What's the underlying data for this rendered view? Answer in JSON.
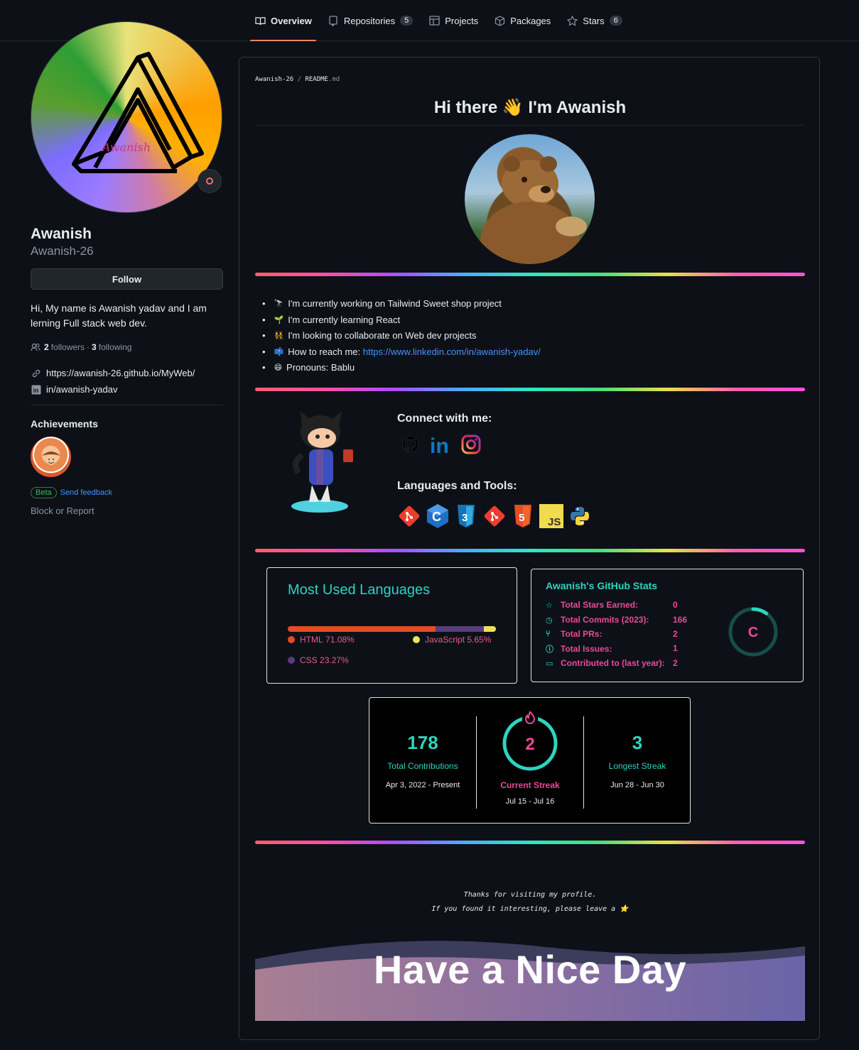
{
  "nav": {
    "tabs": [
      {
        "label": "Overview",
        "count": ""
      },
      {
        "label": "Repositories",
        "count": "5"
      },
      {
        "label": "Projects",
        "count": ""
      },
      {
        "label": "Packages",
        "count": ""
      },
      {
        "label": "Stars",
        "count": "6"
      }
    ]
  },
  "profile": {
    "avatar_text": "Awanish",
    "full_name": "Awanish",
    "username": "Awanish-26",
    "follow_label": "Follow",
    "bio": "Hi, My name is Awanish yadav and I am lerning Full stack web dev.",
    "followers_count": "2",
    "followers_label": "followers",
    "following_count": "3",
    "following_label": "following",
    "website": "https://awanish-26.github.io/MyWeb/",
    "linkedin": "in/awanish-yadav",
    "achievements_title": "Achievements",
    "beta_label": "Beta",
    "feedback_label": "Send feedback",
    "block_label": "Block or Report"
  },
  "readme": {
    "crumb_owner": "Awanish-26",
    "crumb_sep": "/",
    "crumb_file": "README",
    "crumb_ext": ".md",
    "greeting": "Hi there 👋 I'm Awanish",
    "bullets": [
      {
        "icon": "🔭",
        "text": "I'm currently working on Tailwind Sweet shop project"
      },
      {
        "icon": "🌱",
        "text": "I'm currently learning React"
      },
      {
        "icon": "👯",
        "text": "I'm looking to collaborate on Web dev projects"
      },
      {
        "icon": "📫",
        "text": "How to reach me: ",
        "link": "https://www.linkedin.com/in/awanish-yadav/"
      },
      {
        "icon": "😄",
        "text": "Pronouns: Bablu"
      }
    ],
    "connect_title": "Connect with me:",
    "tools_title": "Languages and Tools:",
    "tool_icons": [
      "git-icon",
      "c-icon",
      "css3-icon",
      "git-icon",
      "html5-icon",
      "javascript-icon",
      "python-icon"
    ],
    "social_icons": [
      "github-icon",
      "linkedin-icon",
      "instagram-icon"
    ],
    "thanks_line1": "Thanks for visiting my profile.",
    "thanks_line2": "If you found it interesting, please leave a ⭐",
    "banner_text": "Have a Nice Day"
  },
  "languages_card": {
    "title": "Most Used Languages",
    "items": [
      {
        "name": "HTML",
        "percent": "71.08%",
        "value": 71.08,
        "color": "#e34c26"
      },
      {
        "name": "CSS",
        "percent": "23.27%",
        "value": 23.27,
        "color": "#563d7c"
      },
      {
        "name": "JavaScript",
        "percent": "5.65%",
        "value": 5.65,
        "color": "#f1e05a"
      }
    ]
  },
  "stats_card": {
    "title": "Awanish's GitHub Stats",
    "rows": [
      {
        "icon": "star-icon",
        "label": "Total Stars Earned:",
        "value": "0"
      },
      {
        "icon": "clock-icon",
        "label": "Total Commits (2023):",
        "value": "166"
      },
      {
        "icon": "pull-request-icon",
        "label": "Total PRs:",
        "value": "2"
      },
      {
        "icon": "issue-icon",
        "label": "Total Issues:",
        "value": "1"
      },
      {
        "icon": "repo-icon",
        "label": "Contributed to (last year):",
        "value": "2"
      }
    ],
    "grade": "C",
    "grade_progress": 0.1
  },
  "streak_card": {
    "total": "178",
    "total_label": "Total Contributions",
    "total_range": "Apr 3, 2022 - Present",
    "current": "2",
    "current_label": "Current Streak",
    "current_range": "Jul 15 - Jul 16",
    "longest": "3",
    "longest_label": "Longest Streak",
    "longest_range": "Jun 28 - Jun 30"
  },
  "colors": {
    "accent_teal": "#2dd4bf",
    "accent_pink": "#ec4899",
    "link_blue": "#4493f8",
    "tab_underline": "#f78166"
  }
}
